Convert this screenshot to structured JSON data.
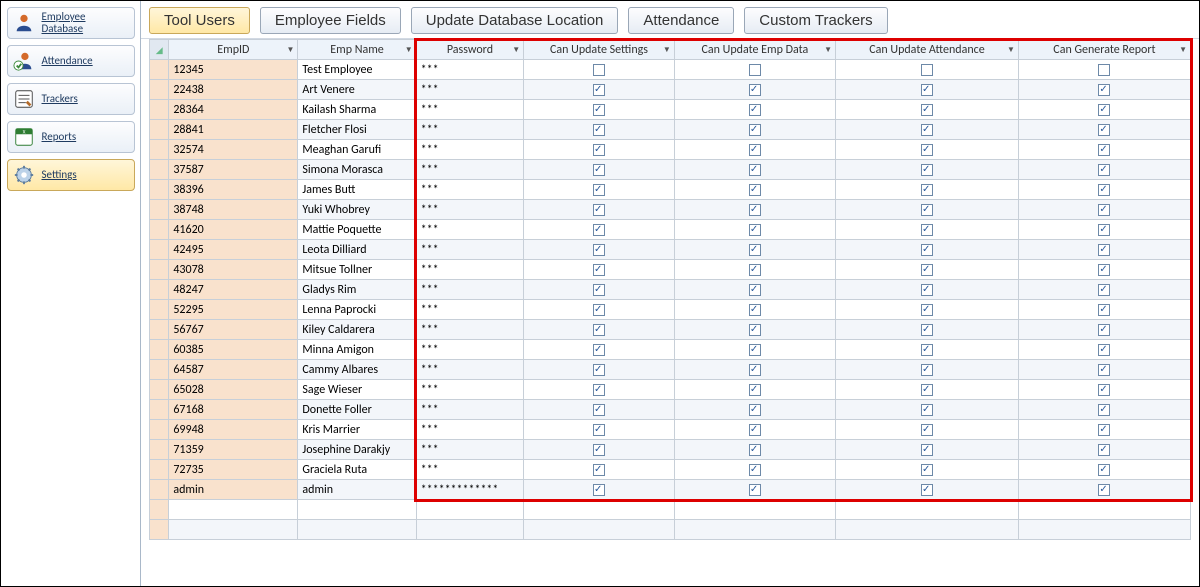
{
  "sidebar": {
    "items": [
      {
        "key": "employee-database",
        "label": "Employee Database"
      },
      {
        "key": "attendance",
        "label": "Attendance"
      },
      {
        "key": "trackers",
        "label": "Trackers"
      },
      {
        "key": "reports",
        "label": "Reports"
      },
      {
        "key": "settings",
        "label": "Settings"
      }
    ],
    "selected": "settings"
  },
  "toolbar": {
    "buttons": [
      {
        "key": "tool-users",
        "label": "Tool Users",
        "active": true
      },
      {
        "key": "employee-fields",
        "label": "Employee Fields",
        "active": false
      },
      {
        "key": "update-db-location",
        "label": "Update Database Location",
        "active": false
      },
      {
        "key": "attendance",
        "label": "Attendance",
        "active": false
      },
      {
        "key": "custom-trackers",
        "label": "Custom Trackers",
        "active": false
      }
    ]
  },
  "grid": {
    "columns": [
      {
        "key": "empid",
        "label": "EmpID"
      },
      {
        "key": "empname",
        "label": "Emp Name"
      },
      {
        "key": "password",
        "label": "Password"
      },
      {
        "key": "can_update_settings",
        "label": "Can Update Settings"
      },
      {
        "key": "can_update_emp_data",
        "label": "Can Update Emp Data"
      },
      {
        "key": "can_update_attendance",
        "label": "Can Update Attendance"
      },
      {
        "key": "can_generate_report",
        "label": "Can Generate Report"
      }
    ],
    "rows": [
      {
        "empid": "12345",
        "empname": "Test Employee",
        "password": "***",
        "can_update_settings": false,
        "can_update_emp_data": false,
        "can_update_attendance": false,
        "can_generate_report": false
      },
      {
        "empid": "22438",
        "empname": "Art Venere",
        "password": "***",
        "can_update_settings": true,
        "can_update_emp_data": true,
        "can_update_attendance": true,
        "can_generate_report": true
      },
      {
        "empid": "28364",
        "empname": "Kailash Sharma",
        "password": "***",
        "can_update_settings": true,
        "can_update_emp_data": true,
        "can_update_attendance": true,
        "can_generate_report": true
      },
      {
        "empid": "28841",
        "empname": "Fletcher Flosi",
        "password": "***",
        "can_update_settings": true,
        "can_update_emp_data": true,
        "can_update_attendance": true,
        "can_generate_report": true
      },
      {
        "empid": "32574",
        "empname": "Meaghan Garufi",
        "password": "***",
        "can_update_settings": true,
        "can_update_emp_data": true,
        "can_update_attendance": true,
        "can_generate_report": true
      },
      {
        "empid": "37587",
        "empname": "Simona Morasca",
        "password": "***",
        "can_update_settings": true,
        "can_update_emp_data": true,
        "can_update_attendance": true,
        "can_generate_report": true
      },
      {
        "empid": "38396",
        "empname": "James Butt",
        "password": "***",
        "can_update_settings": true,
        "can_update_emp_data": true,
        "can_update_attendance": true,
        "can_generate_report": true
      },
      {
        "empid": "38748",
        "empname": "Yuki Whobrey",
        "password": "***",
        "can_update_settings": true,
        "can_update_emp_data": true,
        "can_update_attendance": true,
        "can_generate_report": true
      },
      {
        "empid": "41620",
        "empname": "Mattie Poquette",
        "password": "***",
        "can_update_settings": true,
        "can_update_emp_data": true,
        "can_update_attendance": true,
        "can_generate_report": true
      },
      {
        "empid": "42495",
        "empname": "Leota Dilliard",
        "password": "***",
        "can_update_settings": true,
        "can_update_emp_data": true,
        "can_update_attendance": true,
        "can_generate_report": true
      },
      {
        "empid": "43078",
        "empname": "Mitsue Tollner",
        "password": "***",
        "can_update_settings": true,
        "can_update_emp_data": true,
        "can_update_attendance": true,
        "can_generate_report": true
      },
      {
        "empid": "48247",
        "empname": "Gladys Rim",
        "password": "***",
        "can_update_settings": true,
        "can_update_emp_data": true,
        "can_update_attendance": true,
        "can_generate_report": true
      },
      {
        "empid": "52295",
        "empname": "Lenna Paprocki",
        "password": "***",
        "can_update_settings": true,
        "can_update_emp_data": true,
        "can_update_attendance": true,
        "can_generate_report": true
      },
      {
        "empid": "56767",
        "empname": "Kiley Caldarera",
        "password": "***",
        "can_update_settings": true,
        "can_update_emp_data": true,
        "can_update_attendance": true,
        "can_generate_report": true
      },
      {
        "empid": "60385",
        "empname": "Minna Amigon",
        "password": "***",
        "can_update_settings": true,
        "can_update_emp_data": true,
        "can_update_attendance": true,
        "can_generate_report": true
      },
      {
        "empid": "64587",
        "empname": "Cammy Albares",
        "password": "***",
        "can_update_settings": true,
        "can_update_emp_data": true,
        "can_update_attendance": true,
        "can_generate_report": true
      },
      {
        "empid": "65028",
        "empname": "Sage Wieser",
        "password": "***",
        "can_update_settings": true,
        "can_update_emp_data": true,
        "can_update_attendance": true,
        "can_generate_report": true
      },
      {
        "empid": "67168",
        "empname": "Donette Foller",
        "password": "***",
        "can_update_settings": true,
        "can_update_emp_data": true,
        "can_update_attendance": true,
        "can_generate_report": true
      },
      {
        "empid": "69948",
        "empname": "Kris Marrier",
        "password": "***",
        "can_update_settings": true,
        "can_update_emp_data": true,
        "can_update_attendance": true,
        "can_generate_report": true
      },
      {
        "empid": "71359",
        "empname": "Josephine Darakjy",
        "password": "***",
        "can_update_settings": true,
        "can_update_emp_data": true,
        "can_update_attendance": true,
        "can_generate_report": true
      },
      {
        "empid": "72735",
        "empname": "Graciela Ruta",
        "password": "***",
        "can_update_settings": true,
        "can_update_emp_data": true,
        "can_update_attendance": true,
        "can_generate_report": true
      },
      {
        "empid": "admin",
        "empname": "admin",
        "password": "*************",
        "can_update_settings": true,
        "can_update_emp_data": true,
        "can_update_attendance": true,
        "can_generate_report": true
      }
    ]
  }
}
